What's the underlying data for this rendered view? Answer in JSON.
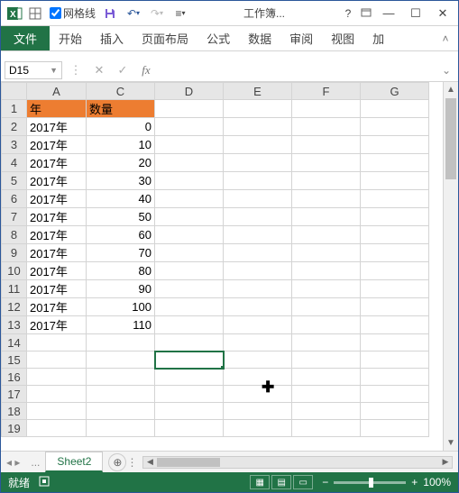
{
  "titlebar": {
    "gridlines_label": "网格线",
    "title": "工作簿...",
    "help": "?"
  },
  "ribbon": {
    "file": "文件",
    "tabs": [
      "开始",
      "插入",
      "页面布局",
      "公式",
      "数据",
      "审阅",
      "视图",
      "加"
    ]
  },
  "formula": {
    "name_box": "D15",
    "fx": "fx"
  },
  "columns": [
    "A",
    "C",
    "D",
    "E",
    "F",
    "G"
  ],
  "headers": {
    "year": "年",
    "qty": "数量"
  },
  "rows": [
    {
      "n": 1,
      "year": "年",
      "qty": "数量",
      "hdr": true
    },
    {
      "n": 2,
      "year": "2017年",
      "qty": "0"
    },
    {
      "n": 3,
      "year": "2017年",
      "qty": "10"
    },
    {
      "n": 4,
      "year": "2017年",
      "qty": "20"
    },
    {
      "n": 5,
      "year": "2017年",
      "qty": "30"
    },
    {
      "n": 6,
      "year": "2017年",
      "qty": "40"
    },
    {
      "n": 7,
      "year": "2017年",
      "qty": "50"
    },
    {
      "n": 8,
      "year": "2017年",
      "qty": "60"
    },
    {
      "n": 9,
      "year": "2017年",
      "qty": "70"
    },
    {
      "n": 10,
      "year": "2017年",
      "qty": "80"
    },
    {
      "n": 11,
      "year": "2017年",
      "qty": "90"
    },
    {
      "n": 12,
      "year": "2017年",
      "qty": "100"
    },
    {
      "n": 13,
      "year": "2017年",
      "qty": "110"
    },
    {
      "n": 14
    },
    {
      "n": 15,
      "selD": true
    },
    {
      "n": 16
    },
    {
      "n": 17
    },
    {
      "n": 18
    },
    {
      "n": 19
    }
  ],
  "sheet": {
    "active": "Sheet2",
    "ellipsis": "..."
  },
  "status": {
    "ready": "就绪",
    "zoom": "100%"
  },
  "chart_data": {
    "type": "table",
    "columns": [
      "年",
      "数量"
    ],
    "data": [
      [
        "2017年",
        0
      ],
      [
        "2017年",
        10
      ],
      [
        "2017年",
        20
      ],
      [
        "2017年",
        30
      ],
      [
        "2017年",
        40
      ],
      [
        "2017年",
        50
      ],
      [
        "2017年",
        60
      ],
      [
        "2017年",
        70
      ],
      [
        "2017年",
        80
      ],
      [
        "2017年",
        90
      ],
      [
        "2017年",
        100
      ],
      [
        "2017年",
        110
      ]
    ]
  }
}
